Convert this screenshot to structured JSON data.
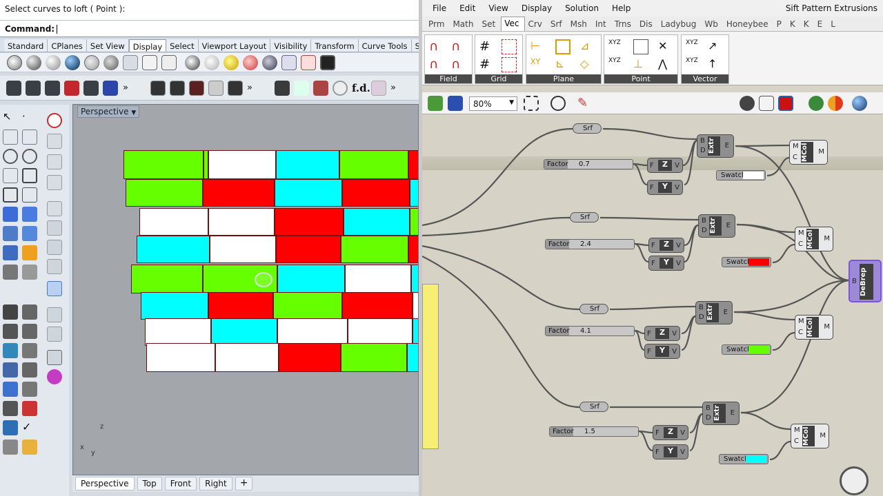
{
  "rhino": {
    "command_prompt": "Select curves to loft ( Point ):",
    "command_label": "Command:",
    "toolbar_tabs": [
      "Standard",
      "CPlanes",
      "Set View",
      "Display",
      "Select",
      "Viewport Layout",
      "Visibility",
      "Transform",
      "Curve Tools",
      "Su"
    ],
    "active_tab": "Display",
    "viewport_title": "Perspective",
    "viewport_tabs": [
      "Perspective",
      "Top",
      "Front",
      "Right",
      "+"
    ],
    "axis_labels": {
      "z": "z",
      "x": "x",
      "y": "y"
    }
  },
  "grasshopper": {
    "menu": [
      "File",
      "Edit",
      "View",
      "Display",
      "Solution",
      "Help"
    ],
    "doc_title": "Sift Pattern Extrusions",
    "tabs": [
      "Prm",
      "Math",
      "Set",
      "Vec",
      "Crv",
      "Srf",
      "Msh",
      "Int",
      "Trns",
      "Dis",
      "Ladybug",
      "Wb",
      "Honeybee",
      "P",
      "K",
      "K",
      "E",
      "L"
    ],
    "active_tab": "Vec",
    "panels": [
      "Field",
      "Grid",
      "Plane",
      "Point",
      "Vector"
    ],
    "zoom": "80%",
    "components": {
      "srf": "Srf",
      "factor": "Factor",
      "extr": "Extr",
      "mcol": "MCol",
      "swatch": "Swatch",
      "debrep": "DeBrep",
      "z": "Z",
      "y": "Y"
    },
    "factor_values": [
      "0.7",
      "2.4",
      "4.1",
      "1.5"
    ],
    "swatch_colors": [
      "#ffffff",
      "#ff0000",
      "#66ff00",
      "#00ffff"
    ],
    "port_letters": {
      "b": "B",
      "d": "D",
      "e": "E",
      "f": "F",
      "v": "V",
      "m": "M",
      "c": "C"
    }
  },
  "colors": {
    "green": "#66ff00",
    "white": "#ffffff",
    "cyan": "#00ffff",
    "red": "#ff0000"
  }
}
